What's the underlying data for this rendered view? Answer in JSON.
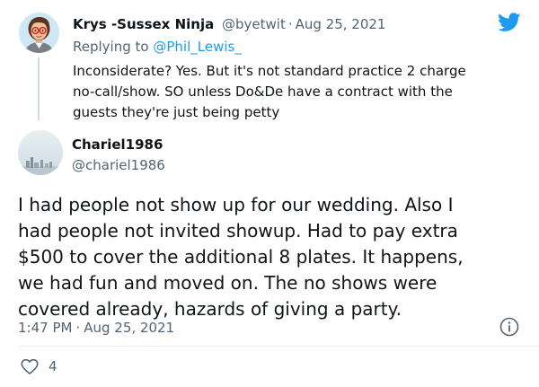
{
  "parent_tweet": {
    "display_name": "Krys -Sussex Ninja",
    "handle": "@byetwit",
    "separator": "·",
    "date": "Aug 25, 2021",
    "replying_prefix": "Replying to",
    "replying_to": "@Phil_Lewis_",
    "body": "Inconsiderate? Yes. But it's not standard practice 2 charge\nno-call/show. SO unless Do&De have a contract with the\nguests they're just being petty",
    "avatar": "bitmoji-avatar-icon"
  },
  "main_tweet": {
    "display_name": "Chariel1986",
    "handle": "@chariel1986",
    "body": "I had people not show up for our wedding.  Also I\nhad people not invited showup. Had to pay extra\n$500 to cover the additional  8 plates. It happens,\nwe had fun and moved on. The no shows were\ncovered already, hazards of giving a party.",
    "time": "1:47 PM",
    "separator": "·",
    "date": "Aug 25, 2021",
    "like_count": "4",
    "avatar": "city-skyline-avatar-icon"
  },
  "icons": {
    "brand": "twitter-bird-icon",
    "info": "info-icon",
    "like": "heart-outline-icon"
  },
  "colors": {
    "accent": "#1d9bf0",
    "secondary_text": "#536471",
    "primary_text": "#0f1419",
    "thread_line": "#cfd9de"
  }
}
